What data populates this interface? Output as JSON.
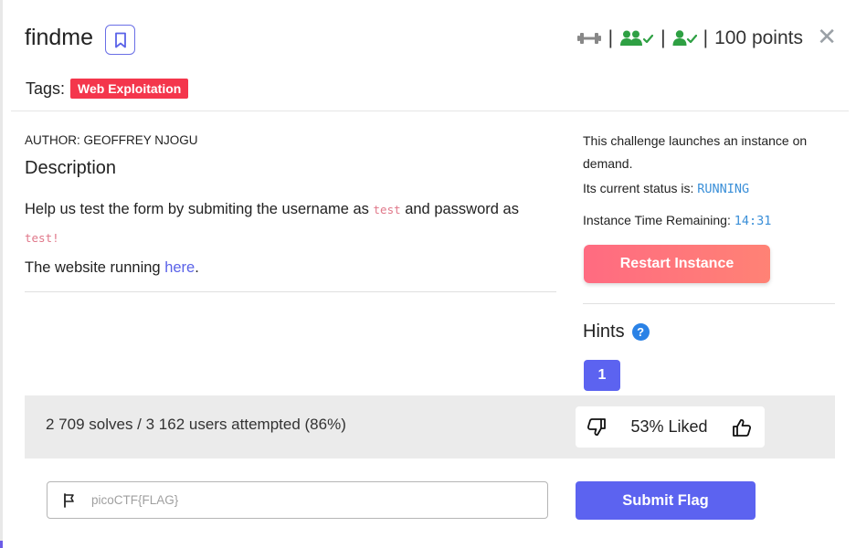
{
  "challenge": {
    "title": "findme",
    "points_label": "100 points",
    "tags_label": "Tags:",
    "tags": [
      "Web Exploitation"
    ],
    "header_icons": [
      "dumbbell-icon",
      "users-check-icon",
      "user-check-icon"
    ]
  },
  "description": {
    "author": "AUTHOR: GEOFFREY NJOGU",
    "heading": "Description",
    "text_before_user": "Help us test the form by submiting the username as ",
    "username_code": "test",
    "text_between": " and password as ",
    "password_code": "test!",
    "line2_prefix": "The website running ",
    "link_text": "here",
    "line2_suffix": "."
  },
  "instance": {
    "launch_text": "This challenge launches an instance on demand.",
    "status_label": "Its current status is: ",
    "status_value": "RUNNING",
    "time_label": "Instance Time Remaining: ",
    "time_value": "14:31",
    "restart_label": "Restart Instance"
  },
  "hints": {
    "heading": "Hints",
    "help_glyph": "?",
    "items": [
      "1"
    ]
  },
  "stats": {
    "solves_text": "2 709 solves / 3 162 users attempted (86%)",
    "liked_text": "53% Liked"
  },
  "flag": {
    "placeholder": "picoCTF{FLAG}",
    "value": "",
    "submit_label": "Submit Flag"
  },
  "colors": {
    "accent": "#5c63f0",
    "tag_red": "#f4364c",
    "restart_gradient_start": "#ff6b81",
    "restart_gradient_end": "#ff8275",
    "success_green": "#2ea043",
    "info_blue": "#2a82e6"
  }
}
